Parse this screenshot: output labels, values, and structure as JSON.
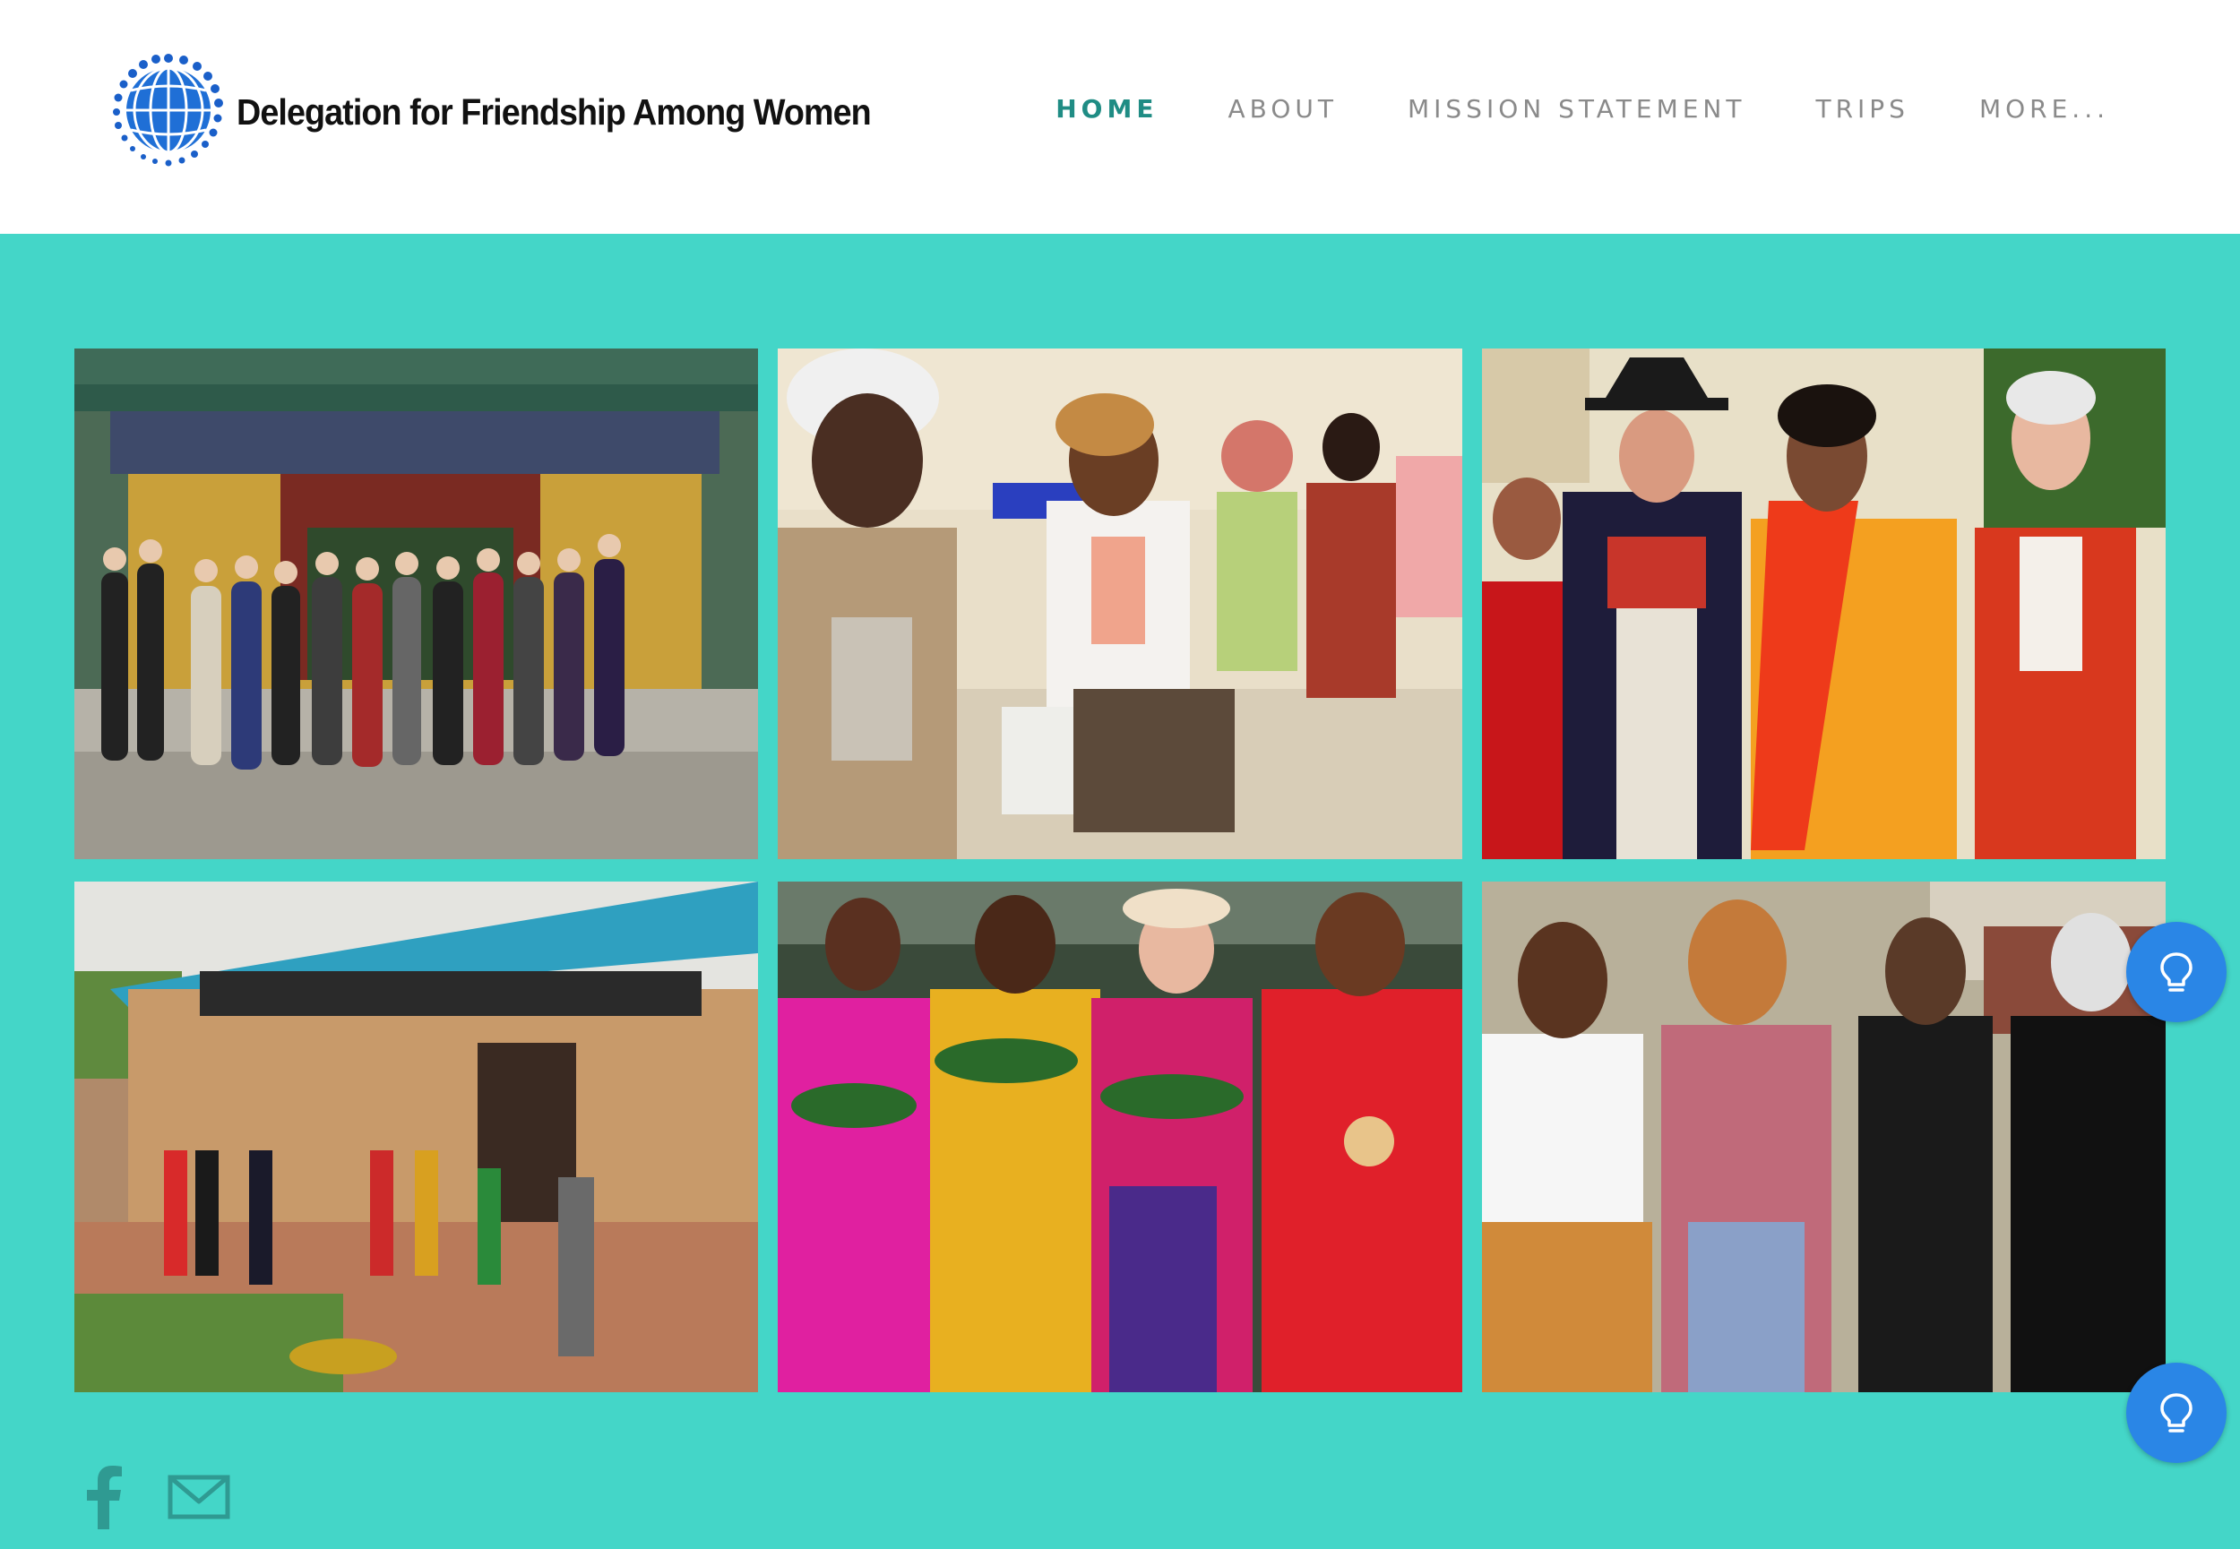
{
  "site": {
    "logo_text": "Delegation for Friendship Among Women",
    "logo_icon": "globe-dots-icon"
  },
  "nav": {
    "items": [
      {
        "label": "HOME",
        "active": true
      },
      {
        "label": "ABOUT",
        "active": false
      },
      {
        "label": "MISSION STATEMENT",
        "active": false
      },
      {
        "label": "TRIPS",
        "active": false
      },
      {
        "label": "MORE...",
        "active": false
      }
    ]
  },
  "gallery": {
    "photos": [
      {
        "subject": "group at temple gate"
      },
      {
        "subject": "women seated in hall"
      },
      {
        "subject": "women in colorful outfits"
      },
      {
        "subject": "group outside brick building"
      },
      {
        "subject": "women with garlands"
      },
      {
        "subject": "women in discussion"
      }
    ]
  },
  "footer": {
    "social_icons": [
      "facebook-icon",
      "mail-icon"
    ]
  },
  "help_buttons": [
    "lightbulb-icon",
    "lightbulb-icon"
  ],
  "colors": {
    "background": "#44d6c8",
    "nav_active": "#1f8c84",
    "nav_default": "#8a8a8a",
    "help_button": "#2a86e6",
    "footer_icon": "#2f9a92"
  }
}
